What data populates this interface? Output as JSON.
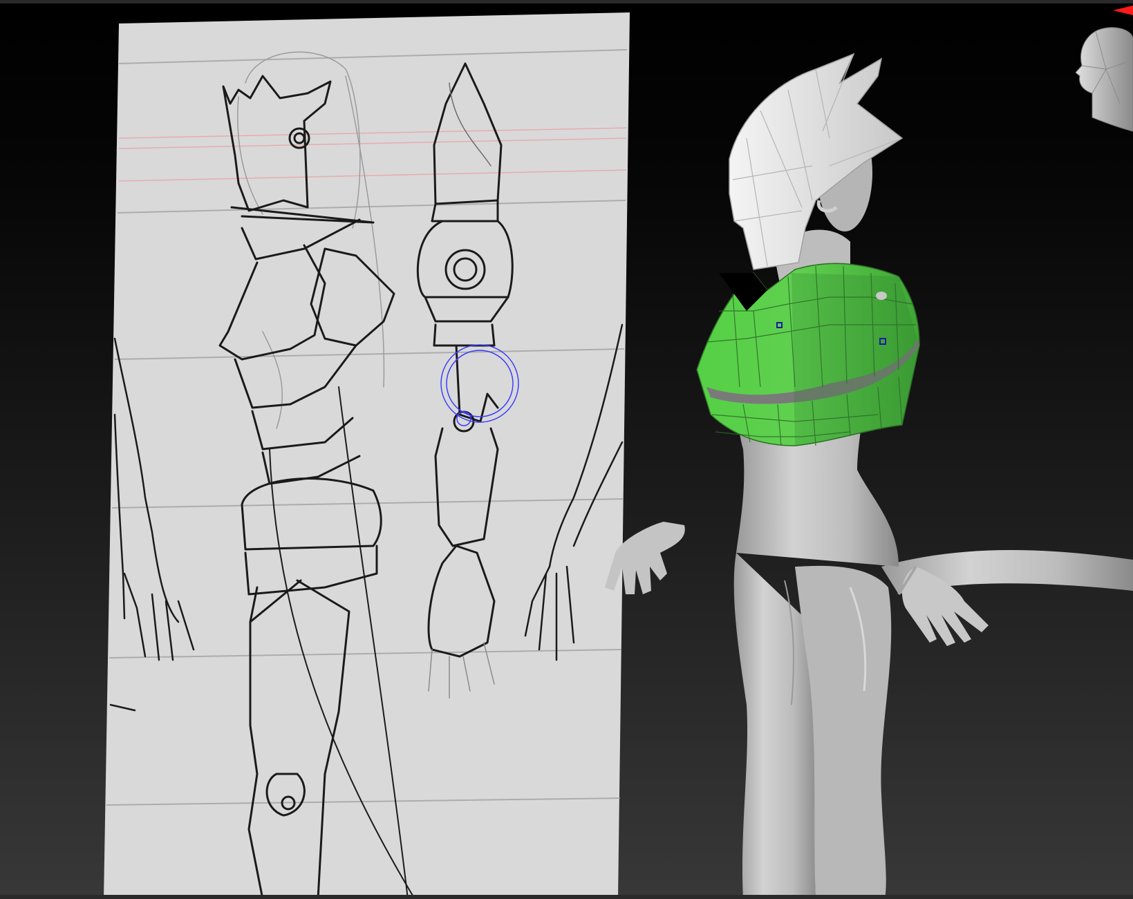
{
  "app": {
    "viewport_label": ""
  },
  "colors": {
    "background_top": "#000000",
    "background_bottom": "#383838",
    "reference_paper": "#d9d9d9",
    "sketch_ink": "#1a1a1a",
    "model_body": "#c2c2c2",
    "model_helmet": "#ececec",
    "selection_mesh": "#55cc44",
    "brush_cursor": "#3d3dff",
    "navigation_indicator": "#ff1a1a"
  },
  "icons": {
    "navigation_head": "head-navigation-icon",
    "brush_cursor": "brush-cursor-icon"
  }
}
